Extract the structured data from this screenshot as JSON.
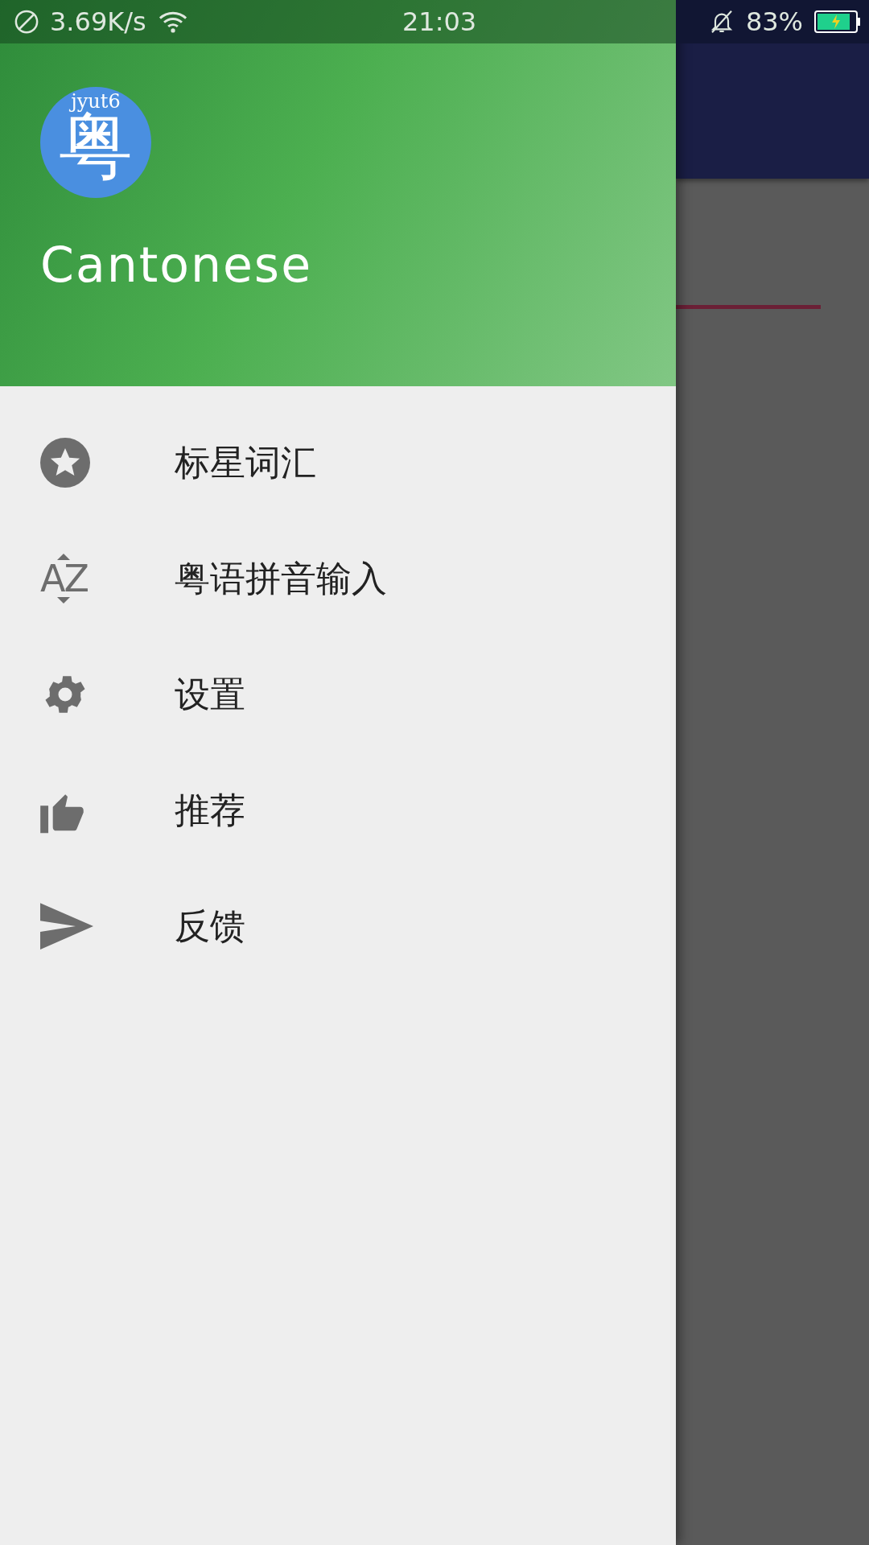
{
  "status_bar": {
    "speed": "3.69K/s",
    "time": "21:03",
    "battery": "83%"
  },
  "drawer": {
    "logo": {
      "romanization": "jyut6",
      "character": "粤"
    },
    "title": "Cantonese",
    "items": [
      {
        "kind": "star",
        "label": "标星词汇"
      },
      {
        "kind": "az",
        "label": "粤语拼音输入",
        "icon_text": "AZ"
      },
      {
        "kind": "settings",
        "label": "设置"
      },
      {
        "kind": "thumb",
        "label": "推荐"
      },
      {
        "kind": "send",
        "label": "反馈"
      }
    ]
  }
}
